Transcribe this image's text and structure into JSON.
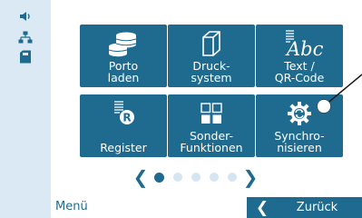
{
  "sidebar": {
    "icons": [
      {
        "name": "volume-icon"
      },
      {
        "name": "network-icon"
      },
      {
        "name": "ink-cartridge-icon"
      }
    ]
  },
  "tiles": [
    {
      "label": "Porto\nladen",
      "icon": "coins-stack-icon"
    },
    {
      "label": "Druck-\nsystem",
      "icon": "print-system-icon"
    },
    {
      "label": "Text /\nQR-Code",
      "icon": "text-abc-icon",
      "icon_text": "Abc"
    },
    {
      "label": "Register",
      "icon": "register-icon"
    },
    {
      "label": "Sonder-\nFunktionen",
      "icon": "grid-functions-icon"
    },
    {
      "label": "Synchro-\nnisieren",
      "icon": "sync-gear-icon"
    }
  ],
  "pager": {
    "prev": "❮",
    "next": "❯",
    "page_count": 5,
    "current_page": 1
  },
  "footer": {
    "menu_label": "Menü",
    "back_chevron": "❮",
    "back_label": "Zurück"
  },
  "colors": {
    "accent": "#1f6b8f",
    "sidebar_bg": "#dbe9f4",
    "dot_inactive": "#d3e6f2"
  }
}
